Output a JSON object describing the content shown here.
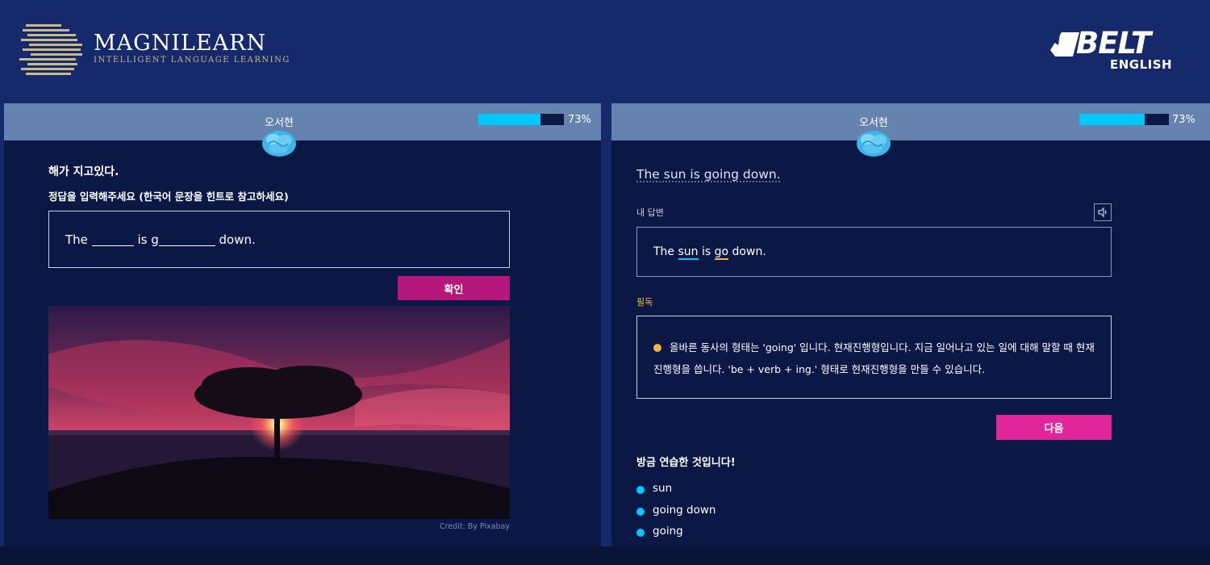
{
  "header": {
    "brand_name": "MAGNILEARN",
    "brand_tagline": "INTELLIGENT LANGUAGE LEARNING",
    "partner_logo_top": "BELT",
    "partner_logo_bottom": "ENGLISH"
  },
  "colors": {
    "page_background": "#16296a",
    "panel_background": "#0b1845",
    "panel_header": "#6583ae",
    "progress_fill": "#00c8ff",
    "confirm_button": "#b5177d",
    "next_button": "#e0269a",
    "feedback_accent": "#f2b83c",
    "list_bullet": "#00c8ff"
  },
  "left_panel": {
    "user_name": "오서현",
    "progress_percent": 73,
    "progress_label": "73%",
    "brain_icon": "brain-icon",
    "korean_sentence": "해가 지고있다.",
    "instruction": "정답을 입력해주세요 (한국어 문장을 힌트로 참고하세요)",
    "exercise": {
      "part1": "The",
      "part2": "is g",
      "part3": "down."
    },
    "confirm_label": "확인",
    "image_credit": "Credit: By Pixabay"
  },
  "right_panel": {
    "user_name": "오서현",
    "progress_percent": 73,
    "progress_label": "73%",
    "brain_icon": "brain-icon",
    "english_sentence": "The sun is going down.",
    "my_answer_label": "내 답변",
    "speaker_icon": "speaker-icon",
    "my_answer": {
      "word1": "The",
      "word2": "sun",
      "word3": "is",
      "word4": "go",
      "word5": "down."
    },
    "feedback_label": "필독",
    "feedback_text": "올바른 동사의 형태는 'going' 입니다. 현재진행형입니다. 지금 일어나고 있는 일에 대해 말할 때 현재진행형을 씁니다. 'be + verb + ing.' 형태로 현재진행형을 만들 수 있습니다.",
    "next_label": "다음",
    "practiced_title": "방금 연습한 것입니다!",
    "practiced_items": [
      "sun",
      "going down",
      "going"
    ]
  }
}
